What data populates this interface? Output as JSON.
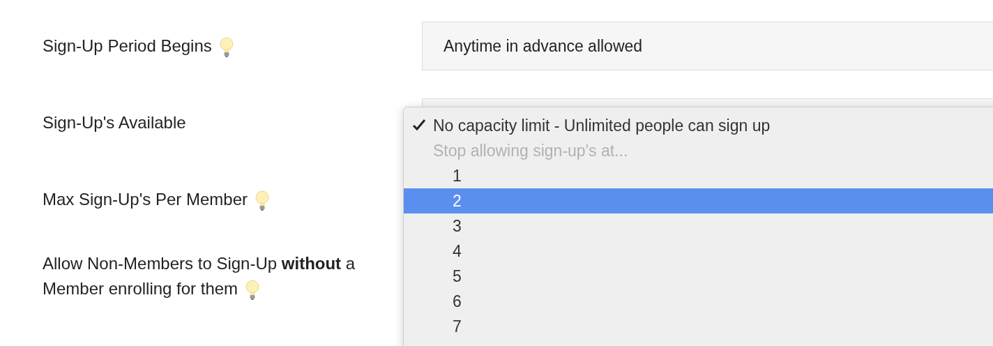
{
  "settings": [
    {
      "label": "Sign-Up Period Begins",
      "hint": true,
      "value": "Anytime in advance allowed"
    },
    {
      "label": "Sign-Up's Available",
      "hint": false
    },
    {
      "label": "Max Sign-Up's Per Member",
      "hint": true
    },
    {
      "label": "Allow Non-Members to Sign-Up **without** a Member enrolling for them",
      "hint": true
    }
  ],
  "dropdown_menu": {
    "items": [
      {
        "kind": "option",
        "label": "No capacity limit - Unlimited people can sign up",
        "checked": true,
        "selected": false
      },
      {
        "kind": "header",
        "label": "Stop allowing sign-up's at..."
      },
      {
        "kind": "option",
        "label": "1",
        "checked": false,
        "selected": false
      },
      {
        "kind": "option",
        "label": "2",
        "checked": false,
        "selected": true
      },
      {
        "kind": "option",
        "label": "3",
        "checked": false,
        "selected": false
      },
      {
        "kind": "option",
        "label": "4",
        "checked": false,
        "selected": false
      },
      {
        "kind": "option",
        "label": "5",
        "checked": false,
        "selected": false
      },
      {
        "kind": "option",
        "label": "6",
        "checked": false,
        "selected": false
      },
      {
        "kind": "option",
        "label": "7",
        "checked": false,
        "selected": false
      }
    ]
  }
}
